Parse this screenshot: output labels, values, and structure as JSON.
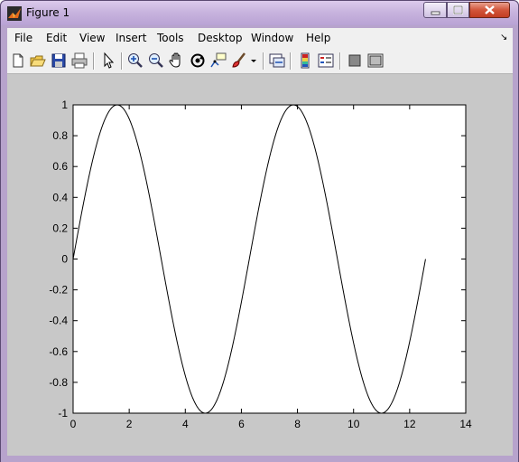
{
  "window": {
    "title": "Figure 1"
  },
  "menus": [
    "File",
    "Edit",
    "View",
    "Insert",
    "Tools",
    "Desktop",
    "Window",
    "Help"
  ],
  "toolbar": {
    "icons": [
      "new-figure-icon",
      "open-file-icon",
      "save-icon",
      "print-icon",
      "edit-plot-arrow-icon",
      "zoom-in-icon",
      "zoom-out-icon",
      "pan-hand-icon",
      "rotate-3d-icon",
      "data-cursor-icon",
      "brush-icon",
      "link-plot-icon",
      "colorbar-icon",
      "legend-icon",
      "hide-plot-tools-icon",
      "show-plot-tools-icon"
    ]
  },
  "chart_data": {
    "type": "line",
    "title": "",
    "xlabel": "",
    "ylabel": "",
    "xlim": [
      0,
      14
    ],
    "ylim": [
      -1,
      1
    ],
    "xticks": [
      "0",
      "2",
      "4",
      "6",
      "8",
      "10",
      "12",
      "14"
    ],
    "yticks": [
      "-1",
      "-0.8",
      "-0.6",
      "-0.4",
      "-0.2",
      "0",
      "0.2",
      "0.4",
      "0.6",
      "0.8",
      "1"
    ],
    "grid": false,
    "series": [
      {
        "function": "sin(x)",
        "x_start": 0,
        "x_end": 12.566,
        "color": "#000000"
      }
    ]
  }
}
